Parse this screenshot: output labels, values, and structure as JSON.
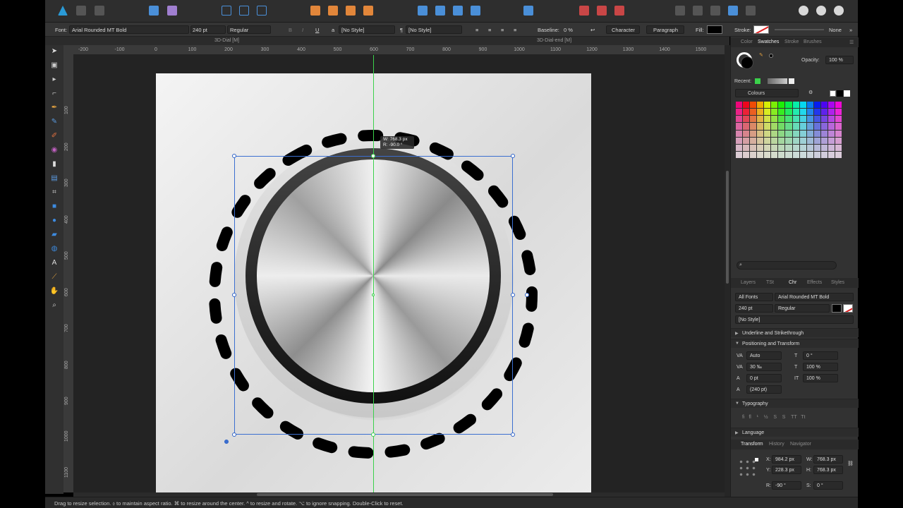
{
  "context_bar": {
    "font_label": "Font:",
    "font_value": "Arial Rounded MT Bold",
    "size_value": "240 pt",
    "weight_value": "Regular",
    "char_style": "[No Style]",
    "para_style": "[No Style]",
    "baseline_label": "Baseline:",
    "baseline_value": "0 %",
    "character_label": "Character",
    "paragraph_label": "Paragraph",
    "fill_label": "Fill:",
    "stroke_label": "Stroke:",
    "stroke_value": "None"
  },
  "doc_tabs": {
    "left": "3D-Dial [M]",
    "right": "3D-Dial-end [M]"
  },
  "hruler": [
    "-200",
    "-100",
    "0",
    "100",
    "200",
    "300",
    "400",
    "500",
    "600",
    "700",
    "800",
    "900",
    "1000",
    "1100",
    "1200",
    "1300",
    "1400",
    "1500"
  ],
  "vruler": [
    "100",
    "200",
    "300",
    "400",
    "500",
    "600",
    "700",
    "800",
    "900",
    "1000",
    "1100"
  ],
  "tooltip": {
    "line1": "W: 768.3 px",
    "line2": "R: -90.0 °"
  },
  "status_bar": {
    "text": "Drag to resize selection. ⬨ to maintain aspect ratio. ⌘ to resize around the center. ^ to resize and rotate. ⌥ to ignore snapping. Double-Click to reset."
  },
  "swatches_panel": {
    "tabs": [
      "Color",
      "Swatches",
      "Stroke",
      "Brushes"
    ],
    "opacity_label": "Opacity:",
    "opacity_value": "100 %",
    "recent_label": "Recent:",
    "palette_name": "Colours"
  },
  "character_panel": {
    "tabs": [
      "Layers",
      "TSt",
      "Chr",
      "Effects",
      "Styles"
    ],
    "font_collection": "All Fonts",
    "font_family": "Arial Rounded MT Bold",
    "font_size": "240 pt",
    "font_style": "Regular",
    "char_style": "[No Style]",
    "sections": {
      "underline": "Underline and Strikethrough",
      "positioning": "Positioning and Transform",
      "typography": "Typography",
      "language": "Language"
    },
    "kerning": "Auto",
    "tracking": "30 ‰",
    "baseline": "0 pt",
    "leading": "(240 pt)",
    "shear": "0 °",
    "scale_v": "100 %",
    "scale_h": "100 %"
  },
  "transform_panel": {
    "tabs": [
      "Transform",
      "History",
      "Navigator"
    ],
    "x_label": "X:",
    "x_value": "984.2 px",
    "y_label": "Y:",
    "y_value": "228.3 px",
    "w_label": "W:",
    "w_value": "768.3 px",
    "h_label": "H:",
    "h_value": "768.3 px",
    "r_label": "R:",
    "r_value": "-90 °",
    "s_label": "S:",
    "s_value": "0 °"
  },
  "colors": {
    "accent": "#3b6fd0",
    "guide": "#3bd14b"
  }
}
